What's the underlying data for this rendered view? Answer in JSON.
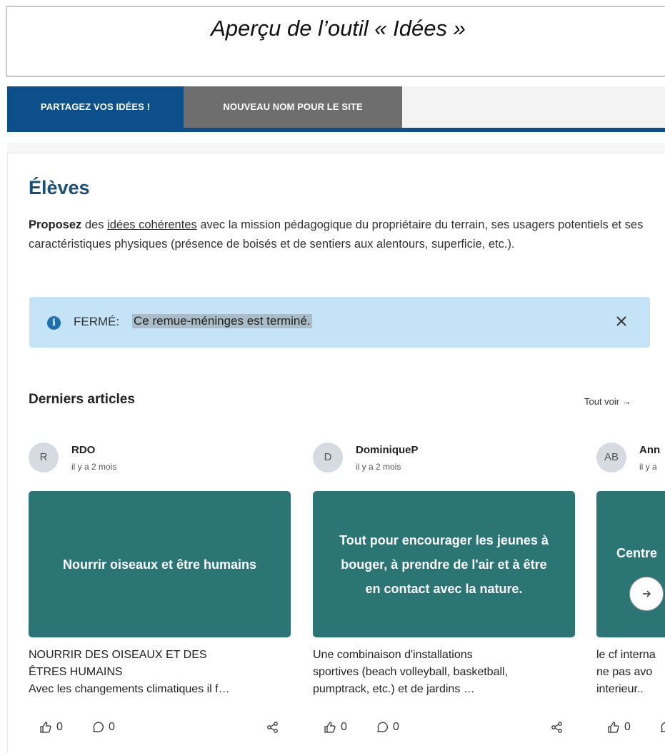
{
  "caption": "Aperçu de l’outil « Idées »",
  "tabs": [
    {
      "label": "PARTAGEZ VOS IDÉES !"
    },
    {
      "label": "NOUVEAU NOM POUR LE SITE"
    }
  ],
  "page": {
    "heading": "Élèves",
    "intro": {
      "bold": "Proposez",
      "text1": " des ",
      "link": "idées cohérentes",
      "text2": " avec la mission pédagogique du propriétaire du terrain, ses usagers potentiels et ses caractéristiques physiques (présence de boisés et de sentiers aux alentours, superficie, etc.)."
    },
    "alert": {
      "prefix": "FERMÉ:",
      "message": "Ce remue-méninges est terminé."
    }
  },
  "articles": {
    "title": "Derniers articles",
    "see_all": "Tout voir →",
    "posts": [
      {
        "initials": "R",
        "author": "RDO",
        "time": "il y a 2 mois",
        "tile_title": "Nourrir oiseaux et être humains",
        "excerpt": [
          "NOURRIR DES OISEAUX ET DES",
          "ÊTRES HUMAINS",
          "Avec les changements climatiques il f…"
        ],
        "likes": "0",
        "comments": "0"
      },
      {
        "initials": "D",
        "author": "DominiqueP",
        "time": "il y a 2 mois",
        "tile_title": "Tout pour encourager les jeunes à bouger, à prendre de l'air et à être en contact avec la nature.",
        "excerpt": [
          "Une combinaison d'installations",
          "sportives (beach volleyball, basketball,",
          "pumptrack, etc.) et de jardins …"
        ],
        "likes": "0",
        "comments": "0"
      },
      {
        "initials": "AB",
        "author": "Ann",
        "time": "il y a",
        "tile_title": "Centre",
        "excerpt": [
          "le cf interna",
          "ne pas avo",
          "interieur.."
        ],
        "likes": "0",
        "comments": ""
      }
    ]
  }
}
